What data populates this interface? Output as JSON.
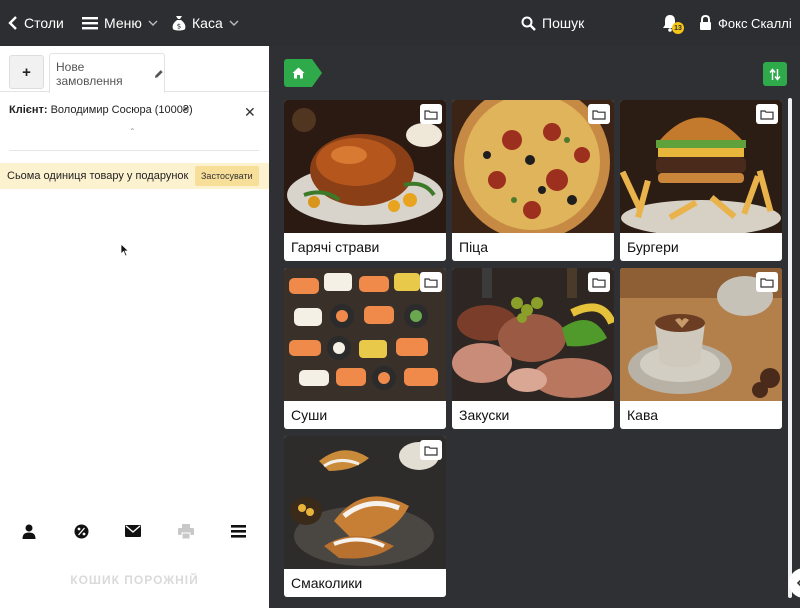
{
  "topbar": {
    "back_label": "Столи",
    "menu_label": "Меню",
    "cash_label": "Каса",
    "search_label": "Пошук",
    "notification_count": "13",
    "user_name": "Фокс Скаллі"
  },
  "order": {
    "add_tab": "+",
    "tab_label": "Нове замовлення",
    "client_label": "Клієнт:",
    "client_value": "Володимир Сосюра (1000₴)",
    "close_symbol": "✕",
    "collapse_symbol": "⌃",
    "promo_text": "Сьома одиниця товару у подарунок",
    "promo_button": "Застосувати",
    "empty_text": "КОШИК ПОРОЖНІЙ",
    "actions": [
      "user-icon",
      "percent-icon",
      "mail-icon",
      "print-icon",
      "list-icon"
    ]
  },
  "categories": [
    {
      "label": "Гарячі страви",
      "image": "roast-chicken"
    },
    {
      "label": "Піца",
      "image": "pizza"
    },
    {
      "label": "Бургери",
      "image": "burger"
    },
    {
      "label": "Суши",
      "image": "sushi"
    },
    {
      "label": "Закуски",
      "image": "cold-cuts"
    },
    {
      "label": "Кава",
      "image": "coffee"
    },
    {
      "label": "Смаколики",
      "image": "pastries"
    }
  ],
  "colors": {
    "accent": "#2faa4a",
    "topbar": "#2c2e31",
    "background": "#2e3033",
    "promo_bg": "#fdf2cf",
    "badge": "#f5c518"
  }
}
